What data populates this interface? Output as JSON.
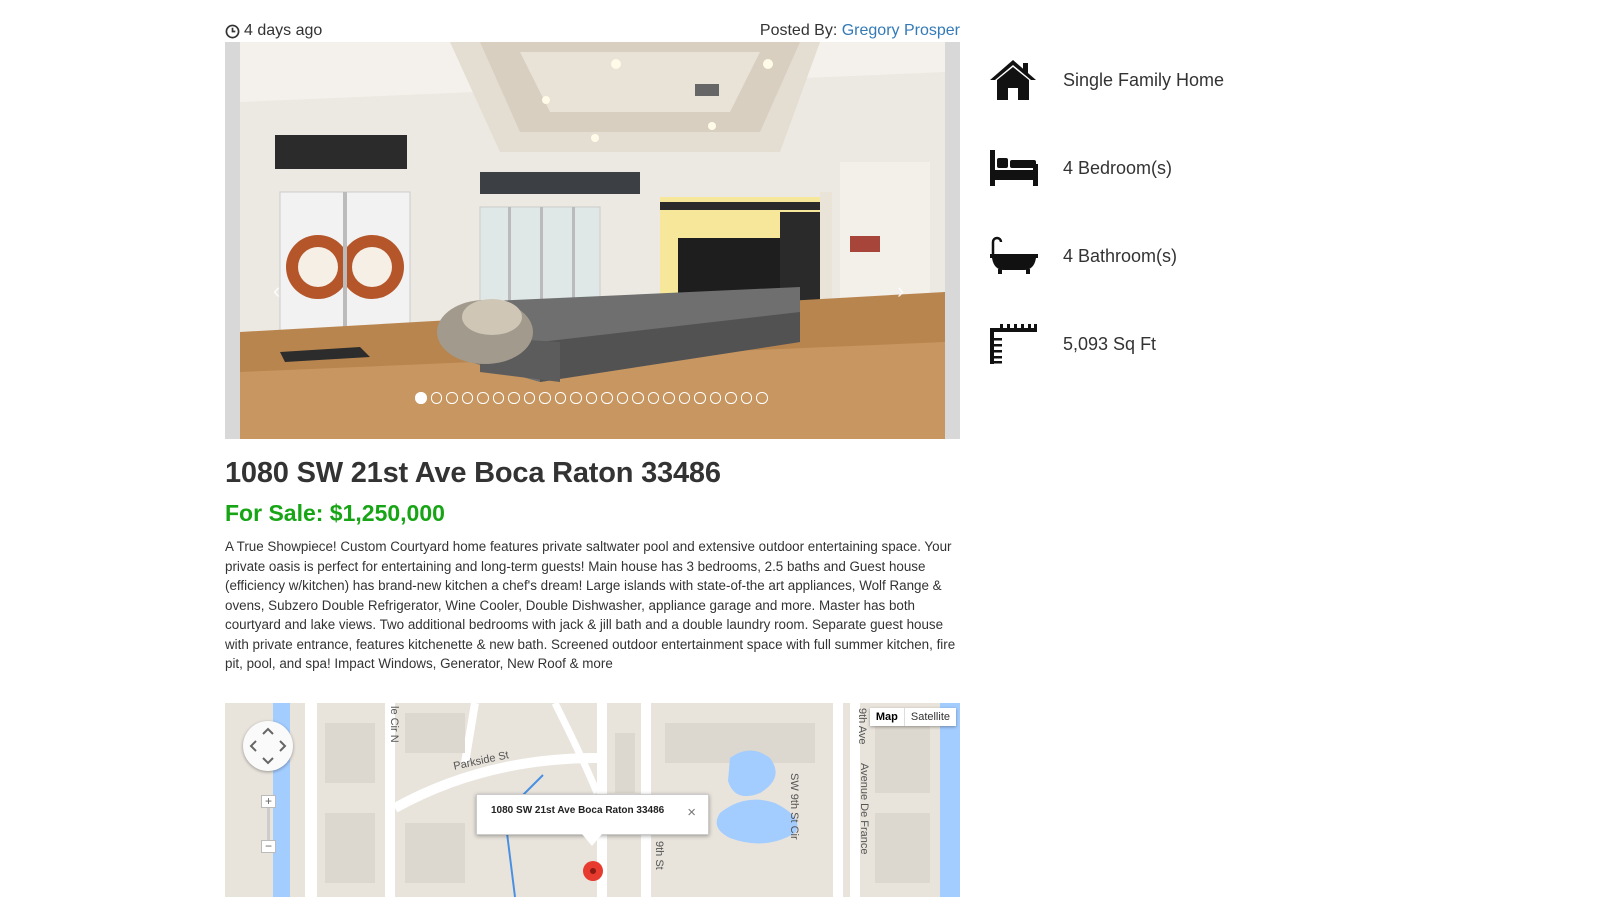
{
  "meta": {
    "posted_ago": "4 days ago",
    "posted_by_label": "Posted By:",
    "posted_by_name": "Gregory Prosper"
  },
  "gallery": {
    "prev_arrow": "‹",
    "next_arrow": "›",
    "dot_count": 23,
    "active_dot": 1
  },
  "listing": {
    "address": "1080 SW 21st Ave Boca Raton 33486",
    "price": "For Sale: $1,250,000",
    "description": "A True Showpiece! Custom Courtyard home features private saltwater pool and extensive outdoor entertaining space. Your private oasis is perfect for entertaining and long-term guests! Main house has 3 bedrooms, 2.5 baths and Guest house (efficiency w/kitchen) has brand-new kitchen a chef's dream! Large islands with state-of-the art appliances, Wolf Range & ovens, Subzero Double Refrigerator, Wine Cooler, Double Dishwasher, appliance garage and more. Master has both courtyard and lake views. Two additional bedrooms with jack & jill bath and a double laundry room. Separate guest house with private entrance, features kitchenette & new bath. Screened outdoor entertainment space with full summer kitchen, fire pit, pool, and spa! Impact Windows, Generator, New Roof & more"
  },
  "features": [
    {
      "icon": "house-icon",
      "label": "Single Family Home"
    },
    {
      "icon": "bed-icon",
      "label": "4 Bedroom(s)"
    },
    {
      "icon": "bathtub-icon",
      "label": "4 Bathroom(s)"
    },
    {
      "icon": "ruler-icon",
      "label": "5,093 Sq Ft"
    }
  ],
  "map": {
    "type_map": "Map",
    "type_satellite": "Satellite",
    "zoom_in": "+",
    "zoom_out": "−",
    "info_text": "1080 SW 21st Ave Boca Raton 33486",
    "info_close": "×",
    "streets": [
      "Parkside St",
      "SW 9th St Cir",
      "Avenue De France",
      "9th Ave",
      "le Cir N",
      "9th St"
    ]
  },
  "colors": {
    "price_green": "#17a516",
    "link_blue": "#337ab7",
    "map_land": "#e8e4dc",
    "map_water": "#a3ccff",
    "map_pin": "#e63b2e"
  }
}
